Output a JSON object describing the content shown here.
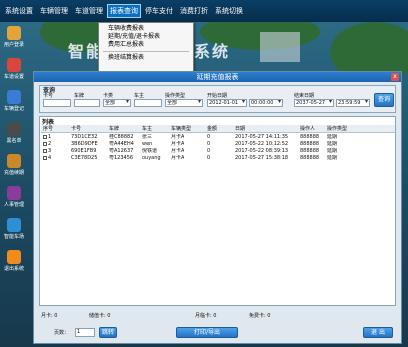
{
  "menu": {
    "items": [
      "系统设置",
      "车辆管理",
      "车道管理",
      "报表查询",
      "停车支付",
      "消费打折",
      "系统切换"
    ],
    "active_index": 3
  },
  "dropdown": {
    "items": [
      "车辆收费报表",
      "延期/充值/退卡报表",
      "费用汇总报表",
      "换班结算报表"
    ]
  },
  "background": {
    "title_left": "智能",
    "title_right": "系统"
  },
  "sidebar": {
    "items": [
      {
        "label": "用户登录",
        "icon": "users-icon",
        "color": "#e2a53a"
      },
      {
        "label": "车道设置",
        "icon": "car-icon",
        "color": "#d9463b"
      },
      {
        "label": "车辆登记",
        "icon": "register-icon",
        "color": "#3a7bd5"
      },
      {
        "label": "黑名单",
        "icon": "blacklist-icon",
        "color": "#4b4b4b"
      },
      {
        "label": "充值续期",
        "icon": "recharge-icon",
        "color": "#c9892a"
      },
      {
        "label": "人事管理",
        "icon": "personnel-icon",
        "color": "#8b3b9a"
      },
      {
        "label": "智能车场",
        "icon": "parking-icon",
        "color": "#2f8fd6"
      },
      {
        "label": "退出系统",
        "icon": "power-icon",
        "color": "#f08c1c"
      }
    ]
  },
  "window": {
    "title": "延期充值报表",
    "close_label": "x"
  },
  "query": {
    "group_title": "查询",
    "fields": {
      "card_no": {
        "label": "卡号",
        "value": ""
      },
      "plate": {
        "label": "车牌",
        "value": ""
      },
      "card_type": {
        "label": "卡类",
        "value": "全部"
      },
      "owner": {
        "label": "车主",
        "value": ""
      },
      "op_type": {
        "label": "操作类型",
        "value": "全部"
      },
      "start_date": {
        "label": "开始日期",
        "value": "2012-01-01",
        "time": "00:00:00"
      },
      "end_date": {
        "label": "结束日期",
        "value": "2037-05-27",
        "time": "23:59:59"
      }
    },
    "search_button": "查询"
  },
  "list": {
    "title": "列表",
    "columns": [
      "序号",
      "卡号",
      "车牌",
      "车主",
      "车辆类型",
      "金额",
      "日期",
      "操作人",
      "操作类型"
    ],
    "rows": [
      [
        "1",
        "73D1CE32",
        "桂C88882",
        "张三",
        "月卡A",
        "0",
        "2017-05-27 14:11:35",
        "888888",
        "延期"
      ],
      [
        "2",
        "3B6D9DFE",
        "粤A44EH4",
        "wen",
        "月卡A",
        "0",
        "2017-05-22 10:12:52",
        "888888",
        "延期"
      ],
      [
        "3",
        "690E1FB9",
        "粤A12637",
        "倪铁道",
        "月卡A",
        "0",
        "2017-05-22 08:39:13",
        "888888",
        "延期"
      ],
      [
        "4",
        "C3E78D25",
        "粤123456",
        "ouyang",
        "月卡A",
        "0",
        "2017-05-27 15:38:18",
        "888888",
        "延期"
      ]
    ]
  },
  "summary": {
    "monthly": {
      "label": "月卡",
      "value": "0"
    },
    "stored": {
      "label": "储值卡",
      "value": "0"
    },
    "temp": {
      "label": "月临卡",
      "value": "0"
    },
    "free": {
      "label": "免费卡",
      "value": "0"
    }
  },
  "pager": {
    "page_label": "页数：",
    "page_value": "1",
    "jump_label": "跳转",
    "print_label": "打印/导出",
    "exit_label": "退 出"
  }
}
